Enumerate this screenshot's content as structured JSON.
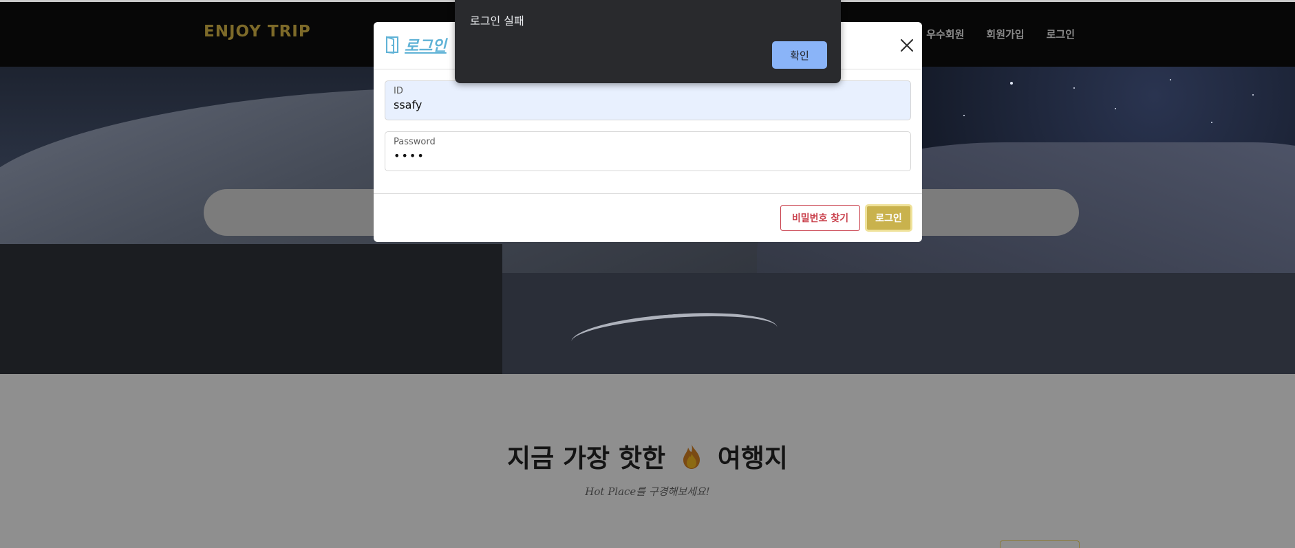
{
  "navbar": {
    "brand": "ENJOY TRIP",
    "links": [
      "우수회원",
      "회원가입",
      "로그인"
    ]
  },
  "content": {
    "title_before": "지금 가장 핫한",
    "title_after": "여행지",
    "subtitle": "Hot Place를 구경해보세요!"
  },
  "modal": {
    "title": "로그인",
    "id_label": "ID",
    "id_value": "ssafy",
    "password_label": "Password",
    "password_value": "••••",
    "find_password_label": "비밀번호 찾기",
    "login_label": "로그인"
  },
  "alert": {
    "message": "로그인 실패",
    "ok_label": "확인"
  },
  "colors": {
    "brand": "#7d6a29",
    "modal_title": "#5fb2d6",
    "find_button": "#c9404c",
    "login_button": "#c9b24d",
    "alert_bg": "#292a2d",
    "alert_button": "#8ab4f8"
  }
}
